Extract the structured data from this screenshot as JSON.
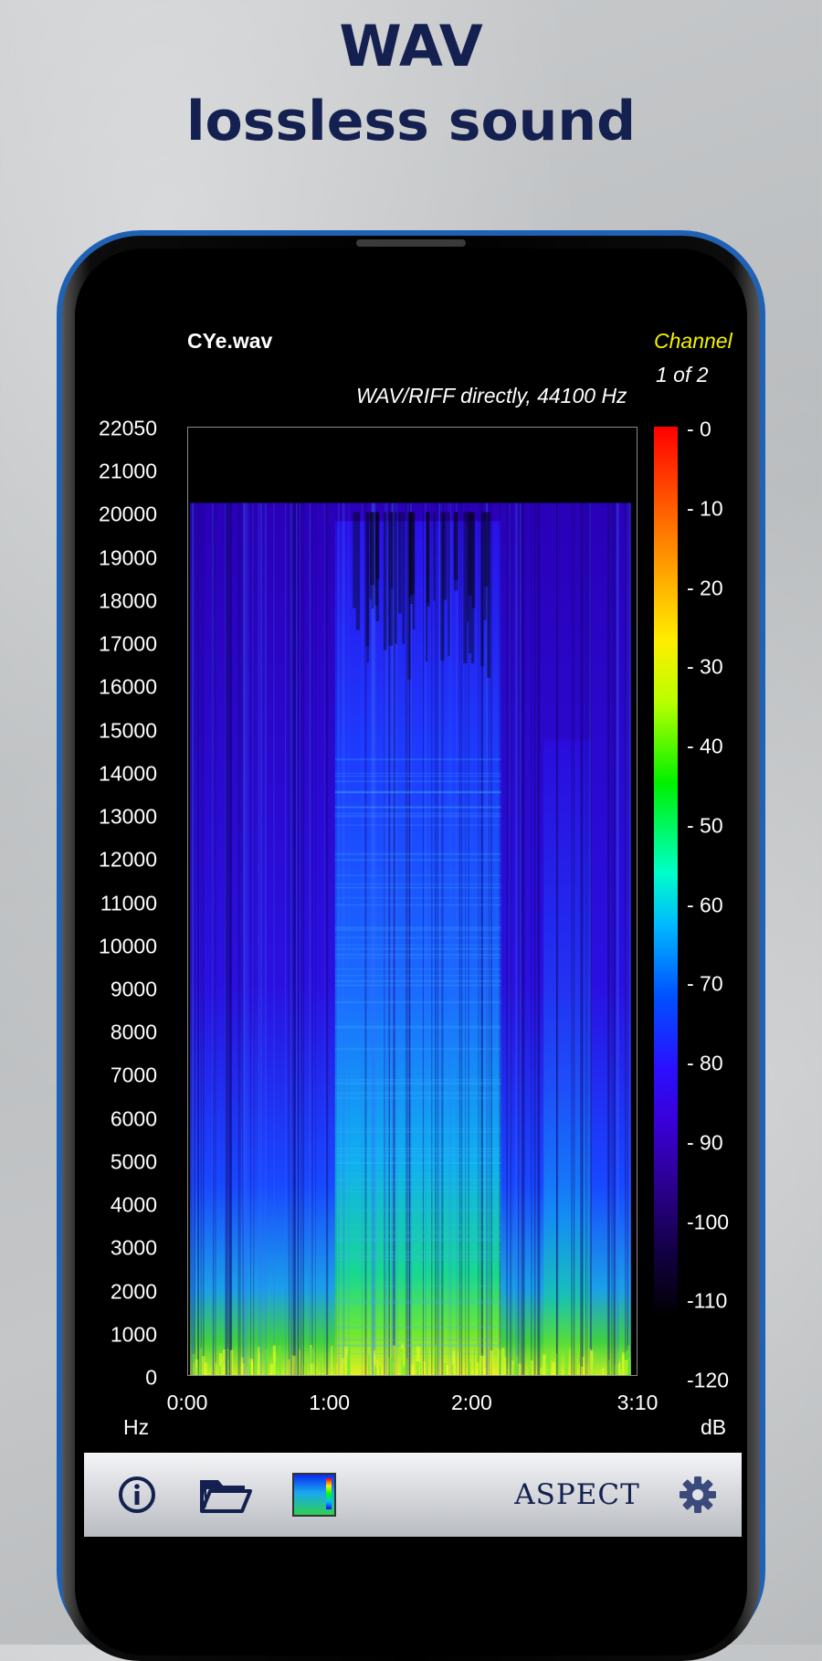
{
  "promo": {
    "title_line1": "WAV",
    "title_line2": "lossless sound"
  },
  "header": {
    "filename": "CYe.wav",
    "channel_label": "Channel",
    "channel_value": "1 of 2",
    "format_info": "WAV/RIFF directly, 44100 Hz"
  },
  "chart_data": {
    "type": "heatmap",
    "xlabel": "",
    "ylabel": "Hz",
    "x_ticks": [
      "0:00",
      "1:00",
      "2:00",
      "3:10"
    ],
    "x_range_seconds": [
      0,
      190
    ],
    "y_ticks": [
      "22050",
      "21000",
      "20000",
      "19000",
      "18000",
      "17000",
      "16000",
      "15000",
      "14000",
      "13000",
      "12000",
      "11000",
      "10000",
      "9000",
      "8000",
      "7000",
      "6000",
      "5000",
      "4000",
      "3000",
      "2000",
      "1000",
      "0"
    ],
    "y_range_hz": [
      0,
      22050
    ],
    "colorbar": {
      "unit": "dB",
      "ticks": [
        "- 0",
        "- 10",
        "- 20",
        "- 30",
        "- 40",
        "- 50",
        "- 60",
        "- 70",
        "- 80",
        "- 90",
        "-100",
        "-110",
        "-120"
      ],
      "range_db": [
        -120,
        0
      ]
    },
    "content_cutoff_hz": 20300
  },
  "units": {
    "y": "Hz",
    "colorbar": "dB"
  },
  "toolbar": {
    "info_icon": "info-icon",
    "folder_icon": "folder-open-icon",
    "palette_icon": "palette-icon",
    "brand": "ASPECT",
    "settings_icon": "gear-icon"
  },
  "colors": {
    "headline": "#14204f",
    "channel_label": "#f4f200",
    "frame": "#1f62b5"
  }
}
